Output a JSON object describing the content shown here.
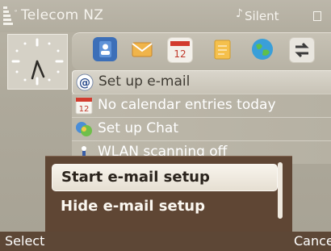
{
  "status_bar": {
    "operator": "Telecom NZ",
    "profile": "Silent",
    "profile_icon": "silent-profile-icon",
    "signal_icon": "signal-strength-icon",
    "battery_icon": "battery-icon"
  },
  "clock": {
    "icon": "analog-clock-icon"
  },
  "shortcuts": [
    {
      "name": "contacts-icon",
      "date": ""
    },
    {
      "name": "messaging-icon",
      "date": ""
    },
    {
      "name": "calendar-icon",
      "date": "12"
    },
    {
      "name": "notes-icon",
      "date": ""
    },
    {
      "name": "web-globe-icon",
      "date": ""
    },
    {
      "name": "switch-arrows-icon",
      "date": ""
    }
  ],
  "list": [
    {
      "label": "Set up e-mail",
      "icon": "email-at-icon"
    },
    {
      "label": "No calendar entries today",
      "icon": "calendar-small-icon",
      "date": "12"
    },
    {
      "label": "Set up Chat",
      "icon": "chat-bubbles-icon"
    },
    {
      "label": "WLAN scanning off",
      "icon": "wlan-icon"
    }
  ],
  "menu": {
    "items": [
      {
        "label": "Start e-mail setup",
        "selected": true
      },
      {
        "label": "Hide e-mail setup",
        "selected": false
      }
    ]
  },
  "softkeys": {
    "left": "Select",
    "right": "Cancel"
  },
  "colors": {
    "background": "#b0ab9d",
    "popup": "#5f4634",
    "highlight": "#f4efe6",
    "text": "#ffffff"
  }
}
